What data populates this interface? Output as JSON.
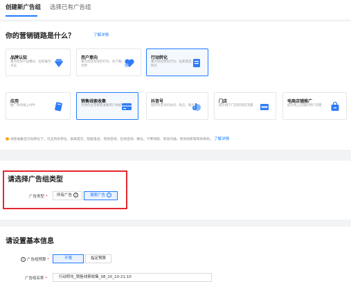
{
  "tabs": [
    {
      "label": "创建新广告组"
    },
    {
      "label": "选择已有广告组"
    }
  ],
  "marketing": {
    "title": "你的营销链路是什么？",
    "link": "了解详情",
    "row1": [
      {
        "title": "品牌认知",
        "desc": "重点优化产品曝光、拉新展示、点击"
      },
      {
        "title": "用户意向",
        "desc": "重点优化有效的行为、拉下载、点赞"
      },
      {
        "title": "行动转化",
        "desc": "重点优化转化行为，拉新激活、购买"
      }
    ],
    "row2": [
      {
        "title": "应用",
        "desc": "推广你的线上APP"
      },
      {
        "title": "销售线索收集",
        "desc": "为你的主营销售收集用户线索"
      },
      {
        "title": "抖音号",
        "desc": "提升抖音号的访问、私信、粉丝"
      },
      {
        "title": "门店",
        "desc": "提升线下门店的到店流量"
      },
      {
        "title": "电商店铺推广",
        "desc": "提升线上店铺的用户流量"
      }
    ],
    "note": "线索收集在行动转化下，可支持多转化、表单提交、智能电话、有效咨询、在线咨询、微信、卡券领取、有效沟通、有效线索等有效目标。",
    "note_link": "了解详情"
  },
  "ad_type": {
    "title": "请选择广告组类型",
    "label": "广告类型",
    "required_mark": "*",
    "options": [
      {
        "label": "所有广告"
      },
      {
        "label": "搜索广告"
      }
    ]
  },
  "basic": {
    "title": "请设置基本信息",
    "budget_label": "广告组预算",
    "budget_options": [
      {
        "label": "不限"
      },
      {
        "label": "指定预算"
      }
    ],
    "name_label": "广告组名称",
    "name_value": "行动转化_销售线索收集_08_10_10:21:10"
  },
  "colors": {
    "accent": "#1f7bff",
    "highlight": "#e5272d"
  }
}
